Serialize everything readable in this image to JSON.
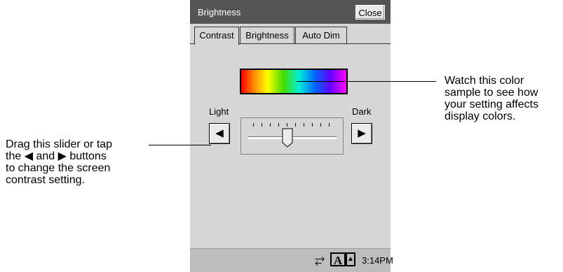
{
  "window": {
    "title": "Brightness",
    "close_label": "Close"
  },
  "tabs": [
    {
      "label": "Contrast",
      "active": true
    },
    {
      "label": "Brightness",
      "active": false
    },
    {
      "label": "Auto Dim",
      "active": false
    }
  ],
  "slider": {
    "light_label": "Light",
    "dark_label": "Dark",
    "left_glyph": "◀",
    "right_glyph": "▶",
    "value": 0.44
  },
  "taskbar": {
    "time": "3:14PM",
    "input_letter": "A"
  },
  "callouts": {
    "left": [
      "Drag this slider or tap",
      "the ◀ and ▶ buttons",
      "to change the screen",
      "contrast setting."
    ],
    "right": [
      "Watch this color",
      "sample to see how",
      "your setting affects",
      "display colors."
    ]
  },
  "colors": {
    "titlebar": "#555555",
    "panel": "#d6d6d6",
    "taskbar": "#bdbdbd"
  }
}
